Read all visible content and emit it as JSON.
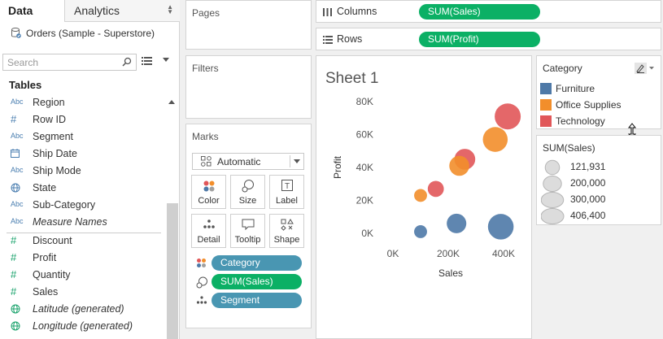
{
  "data_pane": {
    "tab_data": "Data",
    "tab_analytics": "Analytics",
    "datasource": "Orders (Sample - Superstore)",
    "search_placeholder": "Search",
    "tables_heading": "Tables",
    "dimensions": [
      {
        "type": "Abc",
        "label": "Region"
      },
      {
        "type": "#",
        "label": "Row ID"
      },
      {
        "type": "Abc",
        "label": "Segment"
      },
      {
        "type": "date",
        "label": "Ship Date"
      },
      {
        "type": "Abc",
        "label": "Ship Mode"
      },
      {
        "type": "globe",
        "label": "State"
      },
      {
        "type": "Abc",
        "label": "Sub-Category"
      },
      {
        "type": "Abc",
        "label": "Measure Names"
      }
    ],
    "measures": [
      {
        "type": "#",
        "label": "Discount"
      },
      {
        "type": "#",
        "label": "Profit"
      },
      {
        "type": "#",
        "label": "Quantity"
      },
      {
        "type": "#",
        "label": "Sales"
      },
      {
        "type": "globe",
        "label": "Latitude (generated)"
      },
      {
        "type": "globe",
        "label": "Longitude (generated)"
      }
    ]
  },
  "pages": {
    "title": "Pages"
  },
  "filters": {
    "title": "Filters"
  },
  "marks": {
    "title": "Marks",
    "mark_type": "Automatic",
    "buttons": [
      {
        "id": "color",
        "label": "Color",
        "icon": "color-icon"
      },
      {
        "id": "size",
        "label": "Size",
        "icon": "size-icon"
      },
      {
        "id": "label",
        "label": "Label",
        "icon": "label-icon"
      },
      {
        "id": "detail",
        "label": "Detail",
        "icon": "detail-icon"
      },
      {
        "id": "tooltip",
        "label": "Tooltip",
        "icon": "tooltip-icon"
      },
      {
        "id": "shape",
        "label": "Shape",
        "icon": "shape-icon"
      }
    ],
    "pills": [
      {
        "label": "Category",
        "encoding": "color"
      },
      {
        "label": "SUM(Sales)",
        "encoding": "size"
      },
      {
        "label": "Segment",
        "encoding": "detail"
      }
    ]
  },
  "shelves": {
    "columns_label": "Columns",
    "columns_pill": "SUM(Sales)",
    "rows_label": "Rows",
    "rows_pill": "SUM(Profit)"
  },
  "sheet": {
    "title": "Sheet 1"
  },
  "colors": {
    "furniture": "#4e79a7",
    "office_supplies": "#f28e2b",
    "technology": "#e15759",
    "pill_green": "#0bb065",
    "pill_blue": "#4996b2"
  },
  "chart_data": {
    "type": "scatter",
    "title": "Sheet 1",
    "xlabel": "Sales",
    "ylabel": "Profit",
    "x_ticks": [
      "0K",
      "200K",
      "400K"
    ],
    "y_ticks": [
      "0K",
      "20K",
      "40K",
      "60K",
      "80K"
    ],
    "xlim": [
      0,
      430000
    ],
    "ylim": [
      -5000,
      85000
    ],
    "grid": false,
    "series": [
      {
        "name": "Furniture",
        "color": "#4e79a7",
        "points": [
          {
            "x": 100000,
            "y": 1000,
            "size": 100000
          },
          {
            "x": 230000,
            "y": 6000,
            "size": 230000
          },
          {
            "x": 390000,
            "y": 4000,
            "size": 395000
          }
        ]
      },
      {
        "name": "Office Supplies",
        "color": "#f28e2b",
        "points": [
          {
            "x": 100000,
            "y": 23000,
            "size": 100000
          },
          {
            "x": 240000,
            "y": 41000,
            "size": 240000
          },
          {
            "x": 370000,
            "y": 57000,
            "size": 370000
          }
        ]
      },
      {
        "name": "Technology",
        "color": "#e15759",
        "points": [
          {
            "x": 155000,
            "y": 27000,
            "size": 155000
          },
          {
            "x": 260000,
            "y": 45000,
            "size": 260000
          },
          {
            "x": 415000,
            "y": 71000,
            "size": 406400
          }
        ]
      }
    ]
  },
  "color_legend": {
    "title": "Category",
    "items": [
      {
        "label": "Furniture",
        "color": "#4e79a7"
      },
      {
        "label": "Office Supplies",
        "color": "#f28e2b"
      },
      {
        "label": "Technology",
        "color": "#e15759"
      }
    ]
  },
  "size_legend": {
    "title": "SUM(Sales)",
    "items": [
      {
        "label": "121,931",
        "value": 121931
      },
      {
        "label": "200,000",
        "value": 200000
      },
      {
        "label": "300,000",
        "value": 300000
      },
      {
        "label": "406,400",
        "value": 406400
      }
    ]
  }
}
